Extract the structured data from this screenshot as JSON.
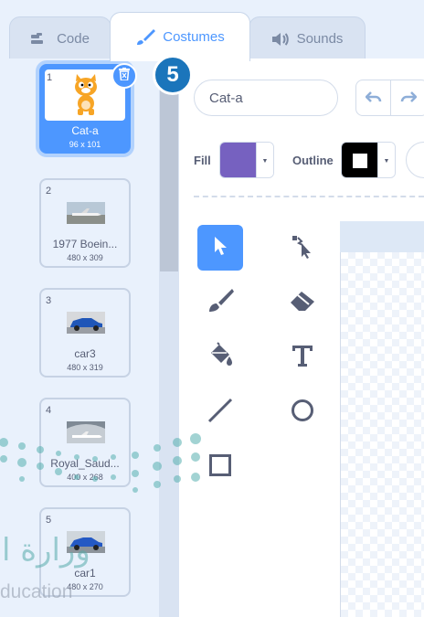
{
  "tabs": {
    "code": {
      "label": "Code",
      "icon": "code-icon"
    },
    "costumes": {
      "label": "Costumes",
      "icon": "brush-icon"
    },
    "sounds": {
      "label": "Sounds",
      "icon": "speaker-icon"
    }
  },
  "costumes": [
    {
      "number": "1",
      "name": "Cat-a",
      "size": "96 x 101",
      "selected": true
    },
    {
      "number": "2",
      "name": "1977 Boein...",
      "size": "480 x 309"
    },
    {
      "number": "3",
      "name": "car3",
      "size": "480 x 319"
    },
    {
      "number": "4",
      "name": "Royal_Saud...",
      "size": "400 x 268"
    },
    {
      "number": "5",
      "name": "car1",
      "size": "480 x 270"
    }
  ],
  "step_badge": "5",
  "editor": {
    "costume_name": "Cat-a",
    "fill_label": "Fill",
    "outline_label": "Outline",
    "fill_color": "#7661c0",
    "outline_color": "#000000"
  },
  "tools": [
    "select-icon",
    "reshape-icon",
    "brush-icon",
    "eraser-icon",
    "fill-icon",
    "text-icon",
    "line-icon",
    "circle-icon",
    "rectangle-icon"
  ],
  "watermark": {
    "arabic": "وزارة ا",
    "english": "ducation"
  },
  "colors": {
    "accent": "#4d97ff",
    "badge": "#1b75bb",
    "panel": "#e9f1fc"
  }
}
